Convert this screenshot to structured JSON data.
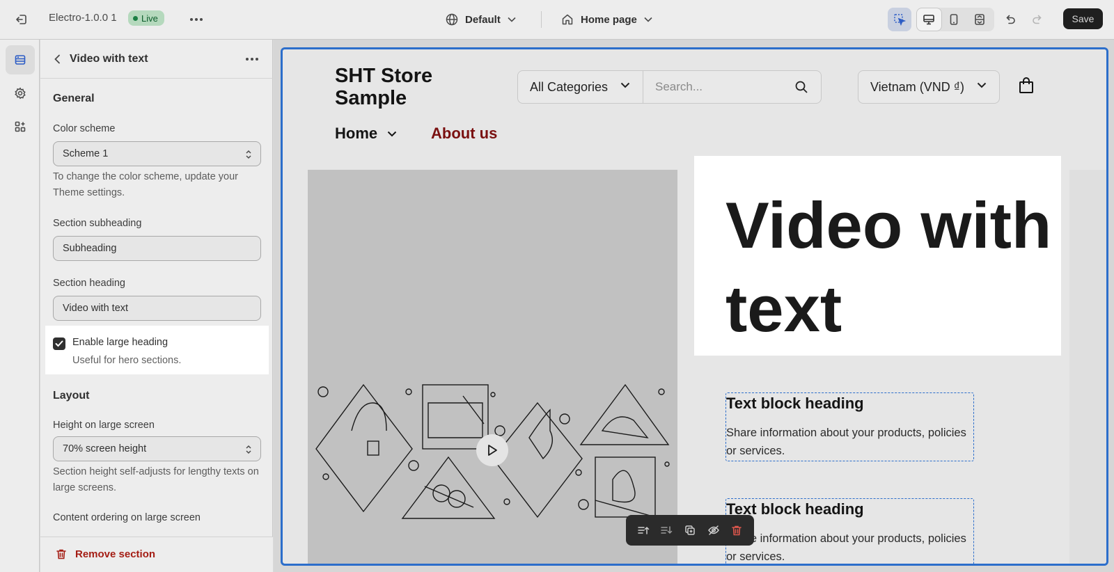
{
  "topbar": {
    "theme_name": "Electro-1.0.0 1",
    "live_label": "Live",
    "template_label": "Default",
    "page_label": "Home page",
    "save_label": "Save"
  },
  "panel": {
    "title": "Video with text",
    "general_title": "General",
    "color_scheme_label": "Color scheme",
    "color_scheme_value": "Scheme 1",
    "color_scheme_help": "To change the color scheme, update your Theme settings.",
    "subheading_label": "Section subheading",
    "subheading_value": "Subheading",
    "heading_label": "Section heading",
    "heading_value": "Video with text",
    "large_heading_label": "Enable large heading",
    "large_heading_help": "Useful for hero sections.",
    "large_heading_checked": true,
    "layout_title": "Layout",
    "height_label": "Height on large screen",
    "height_value": "70% screen height",
    "height_help": "Section height self-adjusts for lengthy texts on large screens.",
    "ordering_label": "Content ordering on large screen",
    "remove_label": "Remove section"
  },
  "preview": {
    "store_name": "SHT Store Sample",
    "category_select": "All Categories",
    "search_placeholder": "Search...",
    "currency": "Vietnam (VND ₫)",
    "nav_home": "Home",
    "nav_about": "About us",
    "heading": "Video with text",
    "text_blocks": [
      {
        "heading": "Text block heading",
        "body": "Share information about your products, policies or services."
      },
      {
        "heading": "Text block heading",
        "body": "Share information about your products, policies or services."
      }
    ]
  },
  "colors": {
    "accent_blue": "#2c6ecb",
    "live_green": "#1a7f43",
    "remove_red": "#a41d14",
    "about_red": "#7a1010"
  },
  "icons": [
    "exit-icon",
    "more-icon",
    "globe-icon",
    "home-icon",
    "chevron-down-icon",
    "inspector-icon",
    "desktop-icon",
    "mobile-icon",
    "fullwidth-icon",
    "undo-icon",
    "redo-icon",
    "sections-icon",
    "settings-icon",
    "apps-icon",
    "back-icon",
    "updown-icon",
    "check-icon",
    "trash-icon",
    "search-icon",
    "bag-icon",
    "play-icon"
  ]
}
